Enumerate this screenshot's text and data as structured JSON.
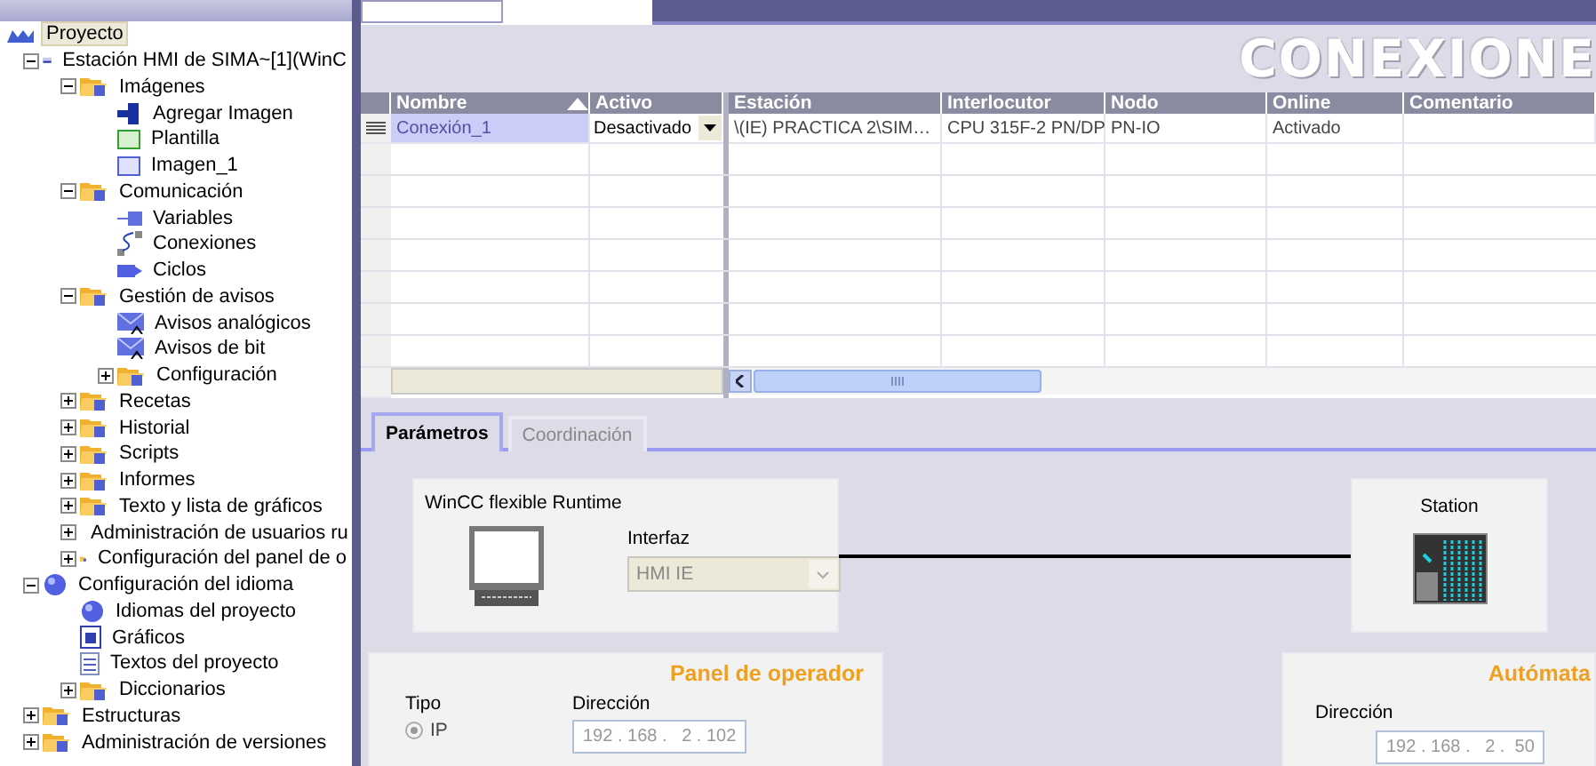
{
  "project_tree": {
    "root": {
      "label": "Proyecto",
      "selected": true
    },
    "items": [
      {
        "label": "Estación HMI de SIMA~[1](WinC",
        "kind": "station",
        "expanded": true,
        "children": [
          {
            "label": "Imágenes",
            "kind": "folder",
            "expanded": true,
            "children": [
              {
                "label": "Agregar Imagen",
                "kind": "add"
              },
              {
                "label": "Plantilla",
                "kind": "template"
              },
              {
                "label": "Imagen_1",
                "kind": "screen"
              }
            ]
          },
          {
            "label": "Comunicación",
            "kind": "folder",
            "expanded": true,
            "children": [
              {
                "label": "Variables",
                "kind": "tags"
              },
              {
                "label": "Conexiones",
                "kind": "connection"
              },
              {
                "label": "Ciclos",
                "kind": "cycle"
              }
            ]
          },
          {
            "label": "Gestión de avisos",
            "kind": "folder",
            "expanded": true,
            "children": [
              {
                "label": "Avisos analógicos",
                "kind": "alarm"
              },
              {
                "label": "Avisos de bit",
                "kind": "alarm"
              },
              {
                "label": "Configuración",
                "kind": "folder",
                "expanded": false
              }
            ]
          },
          {
            "label": "Recetas",
            "kind": "folder",
            "expanded": false
          },
          {
            "label": "Historial",
            "kind": "folder",
            "expanded": false
          },
          {
            "label": "Scripts",
            "kind": "folder",
            "expanded": false
          },
          {
            "label": "Informes",
            "kind": "folder",
            "expanded": false
          },
          {
            "label": "Texto y lista de gráficos",
            "kind": "folder",
            "expanded": false
          },
          {
            "label": "Administración de usuarios ru",
            "kind": "folder",
            "expanded": false
          },
          {
            "label": "Configuración del panel de o",
            "kind": "folder",
            "expanded": false
          }
        ]
      },
      {
        "label": "Configuración del idioma",
        "kind": "globe",
        "expanded": true,
        "children": [
          {
            "label": "Idiomas del proyecto",
            "kind": "globe"
          },
          {
            "label": "Gráficos",
            "kind": "graphic"
          },
          {
            "label": "Textos del proyecto",
            "kind": "text"
          },
          {
            "label": "Diccionarios",
            "kind": "folder",
            "expanded": false
          }
        ]
      },
      {
        "label": "Estructuras",
        "kind": "folder",
        "expanded": false
      },
      {
        "label": "Administración de versiones",
        "kind": "folder",
        "expanded": false
      }
    ]
  },
  "editor": {
    "title": "CONEXIONE",
    "table": {
      "columns": [
        {
          "label": "Nombre",
          "sorted": true
        },
        {
          "label": "Activo",
          "sorted": false
        },
        {
          "label": "Estación",
          "sorted": false
        },
        {
          "label": "Interlocutor",
          "sorted": false
        },
        {
          "label": "Nodo",
          "sorted": false
        },
        {
          "label": "Online",
          "sorted": false
        },
        {
          "label": "Comentario",
          "sorted": false
        }
      ],
      "rows": [
        {
          "selected": true,
          "cells": [
            "Conexión_1",
            "Desactivado",
            "\\(IE) PRACTICA 2\\SIM…",
            "CPU 315F-2 PN/DP",
            "PN-IO",
            "Activado"
          ]
        }
      ]
    },
    "tabs": [
      {
        "label": "Parámetros",
        "selected": true
      },
      {
        "label": "Coordinación",
        "selected": false
      }
    ],
    "hmi_device": {
      "title": "WinCC flexible Runtime",
      "interface_label": "Interfaz",
      "interface": {
        "value": "HMI IE",
        "disabled": true
      }
    },
    "station": {
      "title": "Station"
    },
    "operator_panel": {
      "title": "Panel de operador",
      "type_label": "Tipo",
      "types": [
        {
          "label": "IP",
          "selected": true
        }
      ],
      "address_label": "Dirección",
      "address": "192 . 168 .   2 . 102"
    },
    "plc": {
      "title": "Autómata",
      "address_label": "Dirección",
      "address": "192 . 168 .   2 .  50"
    }
  }
}
